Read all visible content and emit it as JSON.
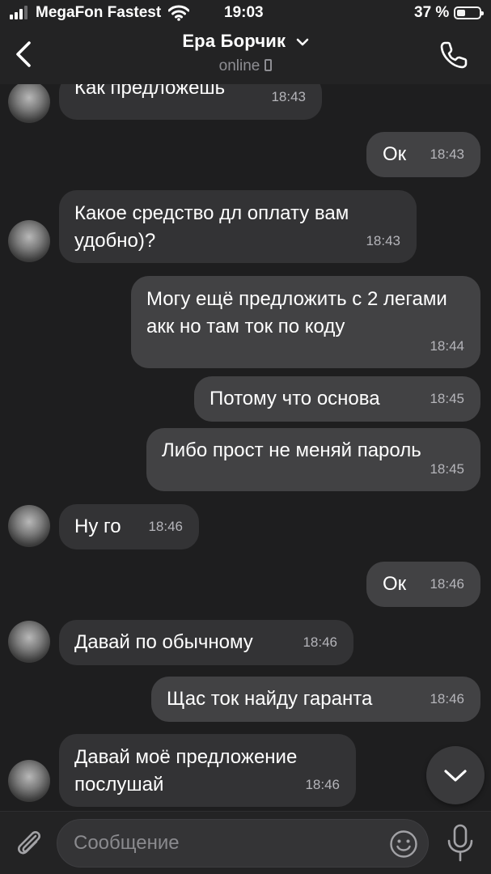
{
  "status_bar": {
    "carrier": "MegaFon Fastest",
    "time": "19:03",
    "battery": "37 %",
    "battery_level": 0.37,
    "signal_bars_active": 3
  },
  "header": {
    "contact_name": "Ера Борчик",
    "presence": "online",
    "icons": [
      "back-arrow-icon",
      "chevron-down-icon",
      "phone-device-icon",
      "phone-call-icon"
    ]
  },
  "messages": [
    {
      "dir": "in",
      "text": "Как предложешь",
      "time": "18:43"
    },
    {
      "dir": "out",
      "text": "Ок",
      "time": "18:43"
    },
    {
      "dir": "in",
      "text": "Какое средство дл оплату вам удобно)?",
      "time": "18:43"
    },
    {
      "dir": "out",
      "text": "Могу ещё предложить с 2 легами акк но там ток по коду",
      "time": "18:44"
    },
    {
      "dir": "out",
      "text": "Потому что основа",
      "time": "18:45"
    },
    {
      "dir": "out",
      "text": "Либо прост не меняй пароль",
      "time": "18:45"
    },
    {
      "dir": "in",
      "text": "Ну го",
      "time": "18:46"
    },
    {
      "dir": "out",
      "text": "Ок",
      "time": "18:46"
    },
    {
      "dir": "in",
      "text": "Давай по обычному",
      "time": "18:46"
    },
    {
      "dir": "out",
      "text": "Щас ток найду гаранта",
      "time": "18:46"
    },
    {
      "dir": "in",
      "text": "Давай моё предложение послушай",
      "time": "18:46"
    }
  ],
  "composer": {
    "placeholder": "Сообщение",
    "value": "",
    "icons": [
      "paperclip-icon",
      "emoji-icon",
      "microphone-icon",
      "chevron-down-icon"
    ]
  },
  "colors": {
    "background": "#1e1e1f",
    "bar": "#232324",
    "incoming_bubble": "#333335",
    "outgoing_bubble": "#424244",
    "timestamp": "#b5b5ba"
  }
}
